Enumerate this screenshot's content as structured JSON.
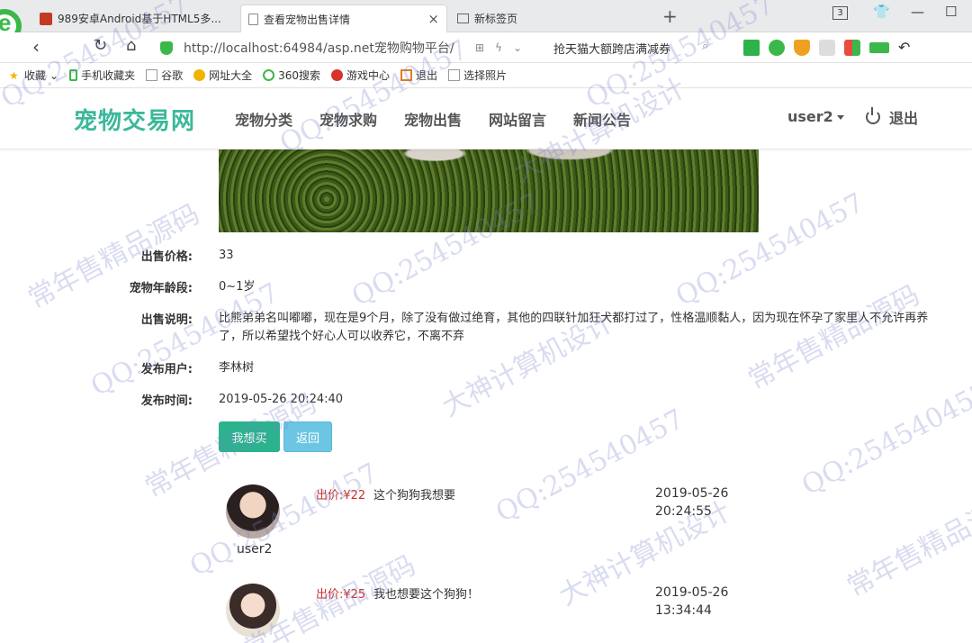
{
  "browser": {
    "tabs": [
      {
        "title": "989安卓Android基于HTML5多..."
      },
      {
        "title": "查看宠物出售详情",
        "close": "×"
      },
      {
        "title": "新标签页"
      }
    ],
    "new_tab": "+",
    "tab_count": "3",
    "url": "http://localhost:64984/asp.net宠物购物平台/",
    "url_host": "localhost",
    "promo": "抢天猫大额跨店满减券",
    "bookmarks": [
      "收藏",
      "手机收藏夹",
      "谷歌",
      "网址大全",
      "360搜索",
      "游戏中心",
      "退出",
      "选择照片"
    ]
  },
  "site": {
    "logo": "宠物交易网",
    "nav": [
      "宠物分类",
      "宠物求购",
      "宠物出售",
      "网站留言",
      "新闻公告"
    ],
    "user": "user2",
    "logout": "退出"
  },
  "detail": {
    "rows": [
      {
        "label": "出售价格:",
        "value": "33"
      },
      {
        "label": "宠物年龄段:",
        "value": "0~1岁"
      },
      {
        "label": "出售说明:",
        "value": "比熊弟弟名叫嘟嘟，现在是9个月，除了没有做过绝育，其他的四联针加狂犬都打过了，性格温顺黏人，因为现在怀孕了家里人不允许再养了，所以希望找个好心人可以收养它，不离不弃"
      },
      {
        "label": "发布用户:",
        "value": "李林树"
      },
      {
        "label": "发布时间:",
        "value": "2019-05-26 20:24:40"
      }
    ],
    "buy_button": "我想买",
    "back_button": "返回"
  },
  "comments": [
    {
      "user": "user2",
      "price": "出价:¥22",
      "text": "这个狗狗我想要",
      "date": "2019-05-26",
      "time": "20:24:55"
    },
    {
      "user": "",
      "price": "出价:¥25",
      "text": "我也想要这个狗狗！",
      "date": "2019-05-26",
      "time": "13:34:44"
    }
  ],
  "watermarks": [
    "常年售精品源码",
    "QQ:254540457",
    "大神计算机设计"
  ],
  "colors": {
    "brand": "#3bb89a",
    "buy": "#2bb38d",
    "back": "#6cc6e3",
    "price": "#c9302c"
  }
}
